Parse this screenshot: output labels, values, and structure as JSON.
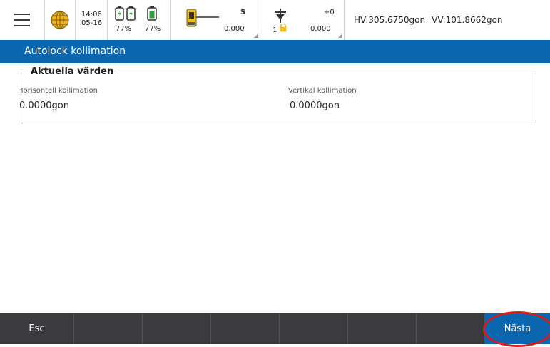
{
  "status": {
    "time": "14:06",
    "date": "05-16",
    "battery1": "77%",
    "battery2": "77%",
    "instrument_mode": "S",
    "instrument_value": "0.000",
    "target_number": "1",
    "target_offset": "+0",
    "target_value": "0.000",
    "hv": "HV:305.6750gon",
    "vv": "VV:101.8662gon"
  },
  "title": "Autolock kollimation",
  "group": {
    "legend": "Aktuella värden",
    "horizontal_label": "Horisontell kollimation",
    "horizontal_value": "0.0000gon",
    "vertical_label": "Vertikal kollimation",
    "vertical_value": "0.0000gon"
  },
  "softkeys": {
    "esc": "Esc",
    "next": "Nästa"
  },
  "colors": {
    "accent": "#0b66b0",
    "softkey_bar": "#3b3b3f",
    "highlight_ring": "#e01919"
  }
}
